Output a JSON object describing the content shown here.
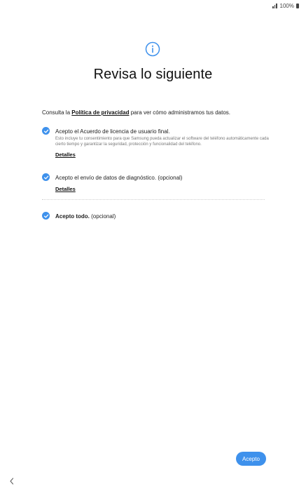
{
  "status_bar": {
    "battery_text": "100%",
    "icons": [
      "signal-icon",
      "battery-icon"
    ]
  },
  "header": {
    "icon": "info-icon",
    "title": "Revisa lo siguiente"
  },
  "intro": {
    "prefix": "Consulta la ",
    "link_label": "Política de privacidad",
    "suffix": " para ver cómo administramos tus datos."
  },
  "items": [
    {
      "label": "Acepto el Acuerdo de licencia de usuario final.",
      "description": "Esto incluye tu consentimiento para que Samsung pueda actualizar el software del teléfono automáticamente cada cierto tiempo y garantizar la seguridad, protección y funcionalidad del teléfono.",
      "details_label": "Detalles",
      "checked": true
    },
    {
      "label": "Acepto el envío de datos de diagnóstico.",
      "optional": "(opcional)",
      "details_label": "Detalles",
      "checked": true
    }
  ],
  "accept_all": {
    "label": "Acepto todo.",
    "optional": "(opcional)",
    "checked": true
  },
  "actions": {
    "accept_label": "Acepto"
  },
  "nav": {
    "back_icon": "chevron-left-icon"
  },
  "colors": {
    "accent": "#3e91ec",
    "text": "#222222",
    "muted": "#777777"
  }
}
